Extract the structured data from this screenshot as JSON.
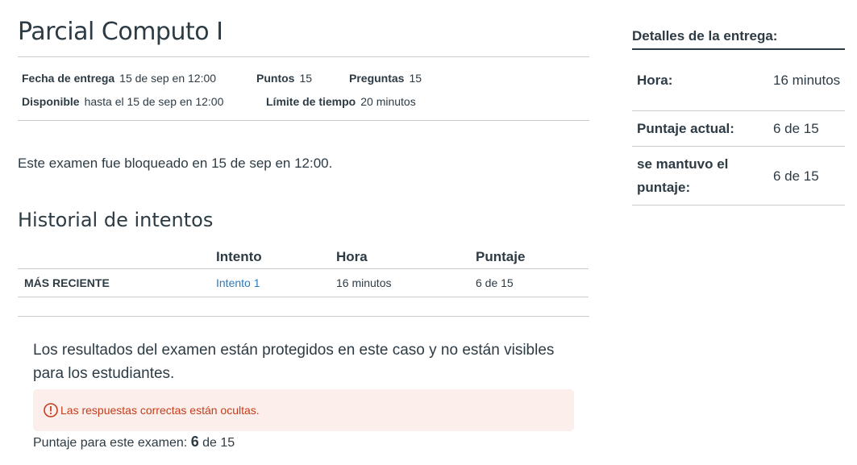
{
  "page_title": "Parcial Computo I",
  "meta": {
    "due_label": "Fecha de entrega",
    "due_value": "15 de sep en 12:00",
    "points_label": "Puntos",
    "points_value": "15",
    "questions_label": "Preguntas",
    "questions_value": "15",
    "available_label": "Disponible",
    "available_value": "hasta el 15 de sep en 12:00",
    "time_limit_label": "Límite de tiempo",
    "time_limit_value": "20 minutos"
  },
  "lock_message": "Este examen fue bloqueado en 15 de sep en 12:00.",
  "history": {
    "title": "Historial de intentos",
    "columns": [
      "",
      "Intento",
      "Hora",
      "Puntaje"
    ],
    "rows": [
      {
        "label": "MÁS RECIENTE",
        "attempt": "Intento 1",
        "time": "16 minutos",
        "score": "6 de 15"
      }
    ]
  },
  "protected_message": "Los resultados del examen están protegidos en este caso y no están visibles para los estudiantes.",
  "alert": {
    "text": "Las respuestas correctas están ocultas.",
    "icon": "warning-circle-icon",
    "color": "#c43d1b",
    "background": "#fbeeeb"
  },
  "score_line": {
    "prefix": "Puntaje para este examen: ",
    "score": "6",
    "suffix": " de 15"
  },
  "details": {
    "title": "Detalles de la entrega:",
    "rows": [
      {
        "label": "Hora:",
        "value": "16 minutos"
      },
      {
        "label": "Puntaje actual:",
        "value": "6 de 15"
      },
      {
        "label": "se mantuvo el puntaje:",
        "value": "6 de 15"
      }
    ]
  },
  "colors": {
    "link": "#2b7abc",
    "text": "#2d3b45",
    "rule": "#c7cdd1"
  }
}
